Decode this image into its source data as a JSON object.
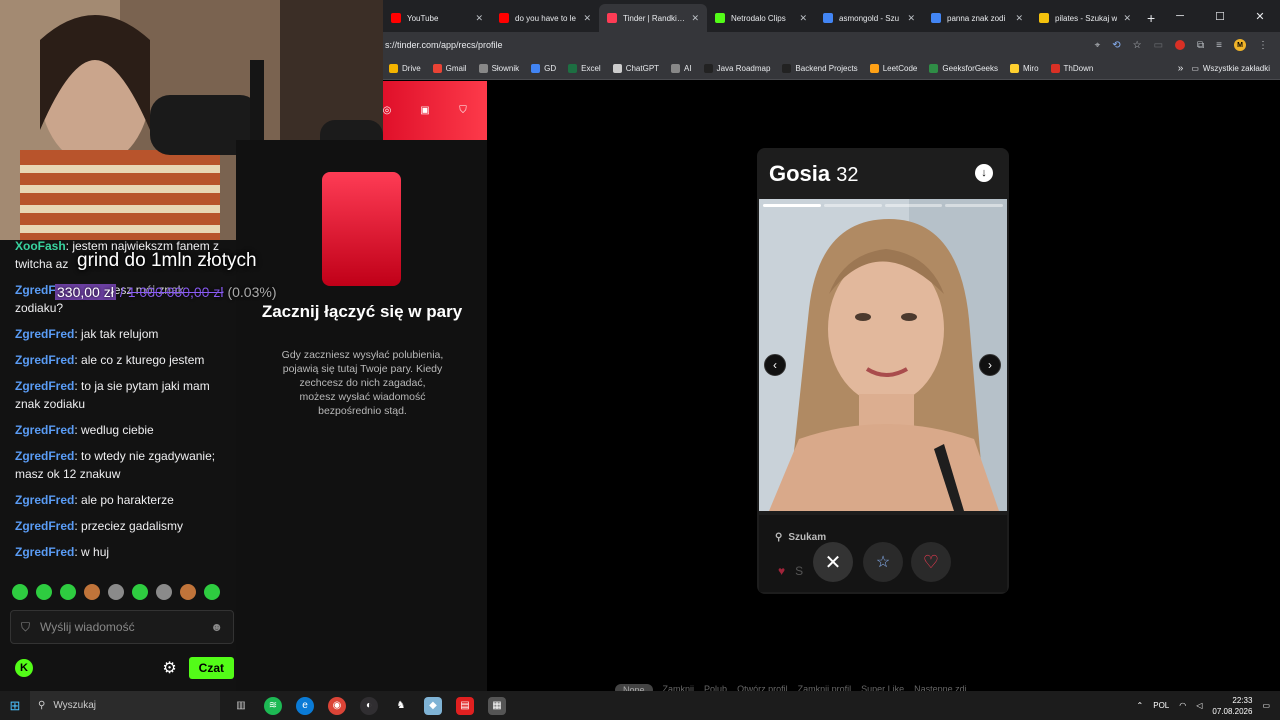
{
  "browser": {
    "tabs": [
      {
        "title": "YouTube",
        "favicon_color": "#ff0000",
        "active": false
      },
      {
        "title": "do you have to le",
        "favicon_color": "#ff0000",
        "active": false
      },
      {
        "title": "Tinder | Randki, p",
        "favicon_color": "#fe3c55",
        "active": true
      },
      {
        "title": "Netrodalo Clips",
        "favicon_color": "#53fc18",
        "active": false
      },
      {
        "title": "asmongold - Szu",
        "favicon_color": "#4285f4",
        "active": false
      },
      {
        "title": "panna znak zodi",
        "favicon_color": "#4285f4",
        "active": false
      },
      {
        "title": "pilates - Szukaj w",
        "favicon_color": "#f4c20d",
        "active": false
      }
    ],
    "new_tab_glyph": "+",
    "url": "s://tinder.com/app/recs/profile",
    "bookmarks": [
      {
        "label": "Drive",
        "color": "#f4b400"
      },
      {
        "label": "Gmail",
        "color": "#ea4335"
      },
      {
        "label": "Słownik",
        "color": "#888888"
      },
      {
        "label": "GD",
        "color": "#4285f4"
      },
      {
        "label": "Excel",
        "color": "#1d6f42"
      },
      {
        "label": "ChatGPT",
        "color": "#cccccc"
      },
      {
        "label": "AI",
        "color": "#888888"
      },
      {
        "label": "Java Roadmap",
        "color": "#222222"
      },
      {
        "label": "Backend Projects",
        "color": "#222222"
      },
      {
        "label": "LeetCode",
        "color": "#ffa116"
      },
      {
        "label": "GeeksforGeeks",
        "color": "#2f8d46"
      },
      {
        "label": "Miro",
        "color": "#ffd02f"
      },
      {
        "label": "ThDown",
        "color": "#d93025"
      }
    ],
    "bookmarks_more": "»",
    "all_bookmarks": "Wszystkie zakładki"
  },
  "tinder": {
    "sidebar": {
      "empty_title": "Zacznij łączyć się w pary",
      "empty_desc": "Gdy zaczniesz wysyłać polubienia, pojawią się tutaj Twoje pary. Kiedy zechcesz do nich zagadać, możesz wysłać wiadomość bezpośrednio stąd."
    },
    "profile": {
      "name": "Gosia",
      "age": "32",
      "photo_count": 4,
      "photo_index": 1,
      "looking_for_label": "Szukam",
      "looking_for_value": "S",
      "looking_for_value_tail": "zku"
    },
    "hints": [
      "Nope",
      "Zamknij",
      "Polub",
      "Otwórz profil",
      "Zamknij profil",
      "Super Like",
      "Następne zdj."
    ]
  },
  "stream": {
    "goal_title": "grind do 1mln złotych",
    "goal_current": "330,00 zł",
    "goal_separator": "/",
    "goal_target": "1 000 000,00 zł",
    "goal_percent": "(0.03%)",
    "messages": [
      {
        "user": "XooFash",
        "text": "jestem najwiekszm fanem z twitcha az",
        "color": "green"
      },
      {
        "user": "ZgredF",
        "text": "ze zgadniesz mój znak zodiaku?",
        "color": "blue"
      },
      {
        "user": "ZgredFred",
        "text": "jak tak relujom",
        "color": "blue"
      },
      {
        "user": "ZgredFred",
        "text": "ale co z kturego jestem",
        "color": "blue"
      },
      {
        "user": "ZgredFred",
        "text": "to ja sie pytam jaki mam znak zodiaku",
        "color": "blue"
      },
      {
        "user": "ZgredFred",
        "text": "wedlug ciebie",
        "color": "blue"
      },
      {
        "user": "ZgredFred",
        "text": "to wtedy nie zgadywanie; masz ok 12 znakuw",
        "color": "blue"
      },
      {
        "user": "ZgredFred",
        "text": "ale po harakterze",
        "color": "blue"
      },
      {
        "user": "ZgredFred",
        "text": "przeciez gadalismy",
        "color": "blue"
      },
      {
        "user": "ZgredFred",
        "text": "w huj",
        "color": "blue"
      }
    ],
    "input_placeholder": "Wyślij wiadomość",
    "chat_button": "Czat",
    "kick_logo": "K"
  },
  "taskbar": {
    "search_placeholder": "Wyszukaj",
    "language": "POL",
    "time": "22:33",
    "date": "07.08.2026"
  },
  "colors": {
    "tinder_red": "#fe3c55",
    "kick_green": "#53fc18",
    "chat_user_blue": "#5a9cf5"
  }
}
